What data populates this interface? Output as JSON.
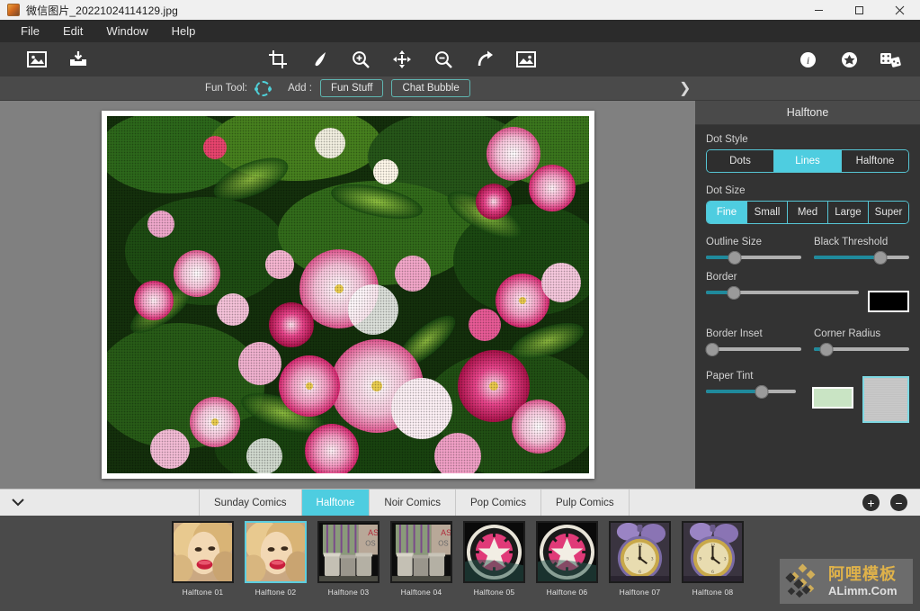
{
  "window": {
    "title": "微信图片_20221024114129.jpg",
    "title_icon": "image-file-icon",
    "controls": {
      "minimize": "minimize-icon",
      "maximize": "maximize-icon",
      "close": "close-icon"
    }
  },
  "menubar": {
    "items": [
      "File",
      "Edit",
      "Window",
      "Help"
    ]
  },
  "toolbar": {
    "left_icons": [
      "open-image-icon",
      "save-image-icon"
    ],
    "center_icons": [
      "crop-icon",
      "brush-icon",
      "zoom-in-icon",
      "move-icon",
      "zoom-out-icon",
      "redo-icon",
      "compare-image-icon"
    ],
    "right_icons": [
      "info-icon",
      "settings-gear-icon",
      "dice-icon"
    ]
  },
  "funbar": {
    "tool_label": "Fun Tool:",
    "tool_icon": "dashed-ellipse-select-icon",
    "add_label": "Add :",
    "buttons": [
      "Fun Stuff",
      "Chat Bubble"
    ],
    "expand_icon": "chevron-right-icon"
  },
  "panel": {
    "title": "Halftone",
    "dot_style": {
      "label": "Dot Style",
      "options": [
        "Dots",
        "Lines",
        "Halftone"
      ],
      "selected": "Lines"
    },
    "dot_size": {
      "label": "Dot Size",
      "options": [
        "Fine",
        "Small",
        "Med",
        "Large",
        "Super"
      ],
      "selected": "Fine"
    },
    "sliders": [
      {
        "label": "Outline Size",
        "value": 30
      },
      {
        "label": "Black Threshold",
        "value": 70
      },
      {
        "label": "Border",
        "value": 18
      },
      {
        "label": "Border Inset",
        "value": 7
      },
      {
        "label": "Corner Radius",
        "value": 13
      },
      {
        "label": "Paper Tint",
        "value": 62
      }
    ],
    "border_color": "#000000",
    "paper_tint_color": "#c9e4c4",
    "paper_texture": "gray-paper-texture-swatch",
    "accent_color": "#4ecde0"
  },
  "tabbar": {
    "collapse_icon": "chevron-down-icon",
    "tabs": [
      "Sunday Comics",
      "Halftone",
      "Noir Comics",
      "Pop Comics",
      "Pulp Comics"
    ],
    "active": "Halftone",
    "add_label": "+",
    "remove_label": "−"
  },
  "filmstrip": {
    "presets": [
      {
        "label": "Halftone 01",
        "selected": false,
        "kind": "portrait"
      },
      {
        "label": "Halftone 02",
        "selected": true,
        "kind": "portrait"
      },
      {
        "label": "Halftone 03",
        "selected": false,
        "kind": "bins"
      },
      {
        "label": "Halftone 04",
        "selected": false,
        "kind": "bins"
      },
      {
        "label": "Halftone 05",
        "selected": false,
        "kind": "star"
      },
      {
        "label": "Halftone 06",
        "selected": false,
        "kind": "star"
      },
      {
        "label": "Halftone 07",
        "selected": false,
        "kind": "clock"
      },
      {
        "label": "Halftone 08",
        "selected": false,
        "kind": "clock"
      }
    ]
  },
  "watermark": {
    "cn": "阿哩模板",
    "en": "ALimm.Com",
    "logo": "diamond-grid-logo"
  },
  "canvas": {
    "image_alt": "halftone-flowers-photo"
  }
}
